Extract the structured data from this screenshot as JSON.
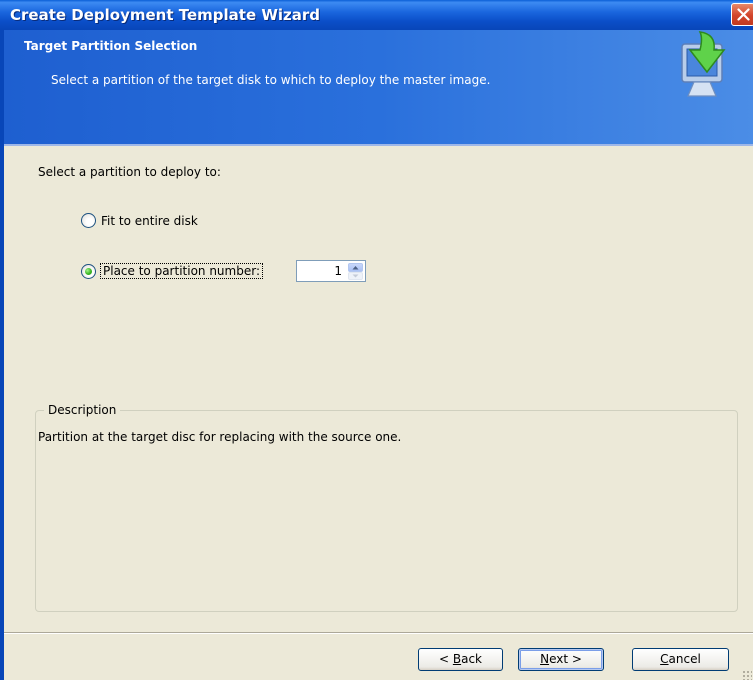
{
  "window": {
    "title": "Create Deployment Template Wizard"
  },
  "header": {
    "title": "Target Partition Selection",
    "subtitle": "Select a partition of the target disk to which to deploy the master image.",
    "icon": "monitor-green-arrow-icon"
  },
  "main": {
    "prompt": "Select a partition to deploy to:",
    "options": [
      {
        "label": "Fit to entire disk",
        "selected": false
      },
      {
        "label": "Place to partition number:",
        "selected": true
      }
    ],
    "partition_number": "1"
  },
  "description": {
    "legend": "Description",
    "text": "Partition at the target disc for replacing with the source one."
  },
  "buttons": {
    "back_prefix": "< ",
    "back_mnemonic": "B",
    "back_rest": "ack",
    "next_mnemonic": "N",
    "next_rest": "ext >",
    "cancel_mnemonic": "C",
    "cancel_rest": "ancel"
  },
  "colors": {
    "title_bar": "#0a5fd6",
    "header": "#2a70dc",
    "face": "#ece9d8",
    "close": "#d2442a"
  }
}
